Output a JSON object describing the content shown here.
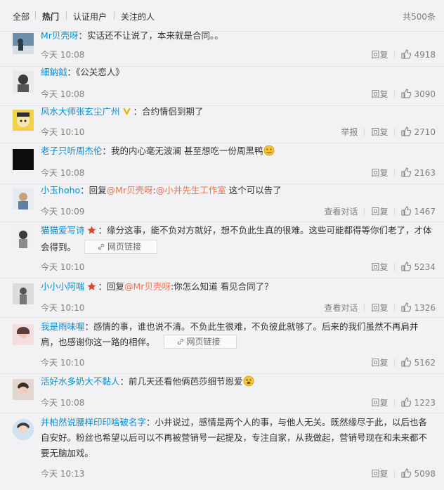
{
  "tabs": {
    "all": "全部",
    "hot": "热门",
    "verified": "认证用户",
    "following": "关注的人"
  },
  "total": "共500条",
  "actions": {
    "reply": "回复",
    "report": "举报",
    "view_conversation": "查看对话",
    "web_link": "网页链接"
  },
  "comments": [
    {
      "user": "Mr贝壳呀",
      "text": "：实话还不让说了，本来就是合同。。",
      "time": "今天 10:08",
      "likes": "4918"
    },
    {
      "user": "細鈉鉞",
      "text": "：《公关恋人》",
      "time": "今天 10:08",
      "likes": "3090"
    },
    {
      "user": "风水大师张玄尘广州",
      "text": "：合约情侣到期了",
      "time": "今天 10:10",
      "likes": "2710"
    },
    {
      "user": "老子只听周杰伦",
      "text": "：我的内心毫无波澜 甚至想吃一份周黑鸭",
      "time": "今天 10:08",
      "likes": "2163"
    },
    {
      "user": "小玉hoho",
      "text_pre": "：回复",
      "mention1": "@Mr贝壳呀",
      "text_mid": ":",
      "mention2": "@小井先生工作室",
      "text_post": " 这个可以告了",
      "time": "今天 10:09",
      "likes": "1467"
    },
    {
      "user": "猫猫爱写诗",
      "text": "：缘分这事，能不负对方就好，想不负此生真的很难。这些可能都得等你们老了，才体会得到。",
      "time": "今天 10:10",
      "likes": "5234"
    },
    {
      "user": "小小小阿嗤",
      "text_pre": "：回复",
      "mention1": "@Mr贝壳呀",
      "text_post": ":你怎么知道 看见合同了？",
      "time": "今天 10:10",
      "likes": "1326"
    },
    {
      "user": "我是雨味喔",
      "text": "：感情的事，谁也说不清。不负此生很难，不负彼此就够了。后来的我们虽然不再肩并肩，也感谢你这一路的相伴。",
      "time": "今天 10:10",
      "likes": "5162"
    },
    {
      "user": "活好水多奶大不黏人",
      "text": "：前几天还看他俩芭莎细节恩爱",
      "time": "今天 10:08",
      "likes": "1223"
    },
    {
      "user": "并柏然说腰样印印啥破名字",
      "text": "：小井说过，感情是两个人的事，与他人无关。既然缘尽于此，以后也各自安好。粉丝也希望以后可以不再被营销号一起提及，专注自家，从我做起，营销号现在和未来都不要无脑加戏。",
      "time": "今天 10:13",
      "likes": "5098"
    }
  ]
}
